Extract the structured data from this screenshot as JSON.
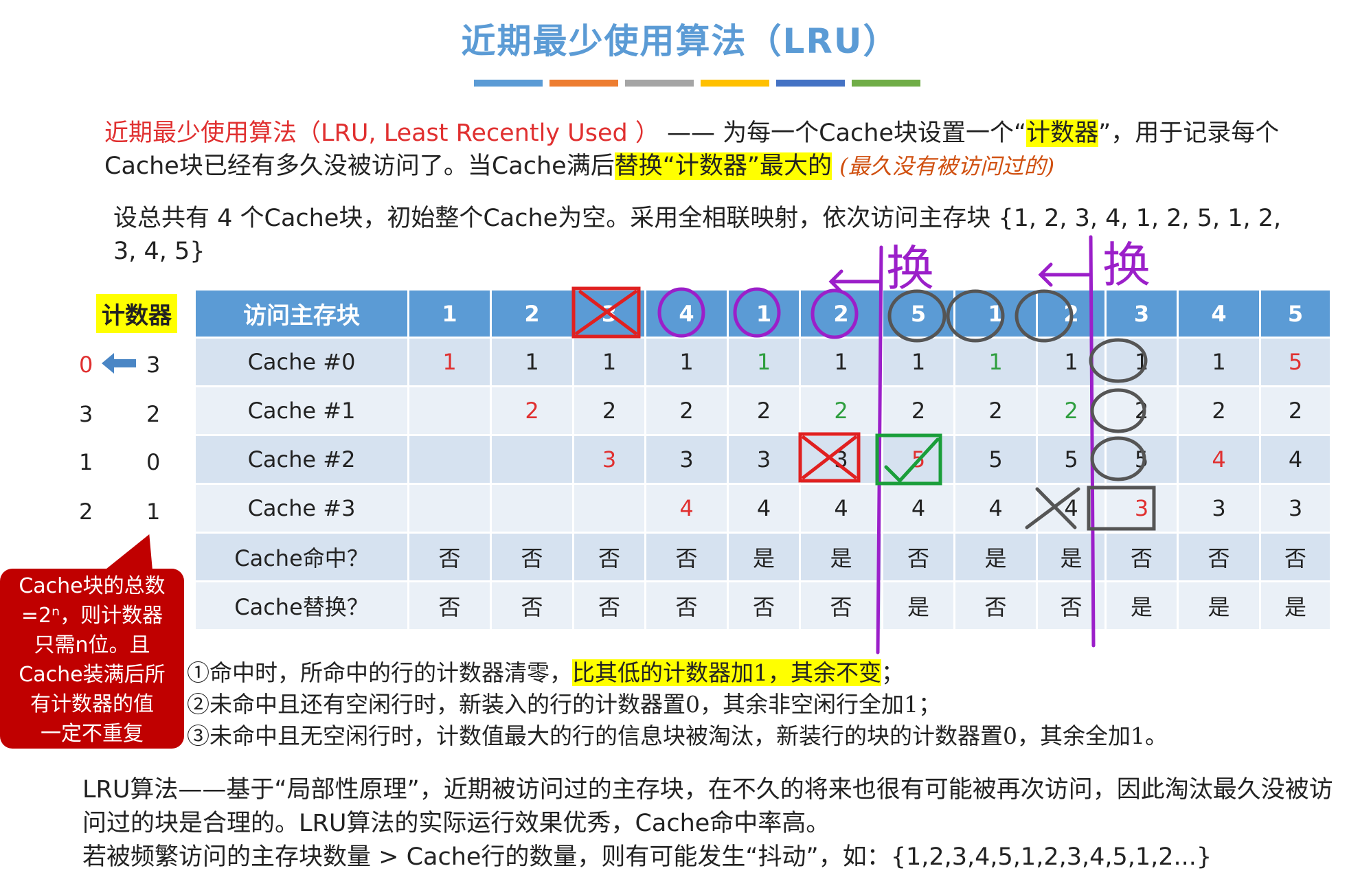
{
  "title": "近期最少使用算法（LRU）",
  "title_bar_colors": [
    "#5b9bd5",
    "#ed7d31",
    "#a5a5a5",
    "#ffc000",
    "#4472c4",
    "#70ad47"
  ],
  "intro": {
    "term": "近期最少使用算法（LRU, Least Recently Used ）",
    "dash": "——",
    "part1": " 为每一个Cache块设置一个“",
    "counter": "计数器",
    "part2": "”，用于记录每个Cache块已经有多久没被访问了。当Cache满后",
    "replace_rule": "替换“计数器”最大的",
    "handwritten_note": "(最久没有被访问过的)"
  },
  "problem": "设总共有 4 个Cache块，初始整个Cache为空。采用全相联映射，依次访问主存块 {1, 2, 3, 4, 1, 2, 5, 1, 2, 3, 4, 5}",
  "counter_label": "计数器",
  "counters": [
    {
      "before": "0",
      "after": "3"
    },
    {
      "before": "3",
      "after": "2"
    },
    {
      "before": "1",
      "after": "0"
    },
    {
      "before": "2",
      "after": "1"
    }
  ],
  "table": {
    "header": "访问主存块",
    "accesses": [
      "1",
      "2",
      "3",
      "4",
      "1",
      "2",
      "5",
      "1",
      "2",
      "3",
      "4",
      "5"
    ],
    "rows": [
      {
        "label": "Cache #0",
        "cells": [
          "1",
          "1",
          "1",
          "1",
          "1",
          "1",
          "1",
          "1",
          "1",
          "1",
          "1",
          "5"
        ],
        "status": [
          "new",
          "",
          "",
          "",
          "hit",
          "",
          "",
          "hit",
          "",
          "",
          "",
          "new"
        ]
      },
      {
        "label": "Cache #1",
        "cells": [
          "",
          "2",
          "2",
          "2",
          "2",
          "2",
          "2",
          "2",
          "2",
          "2",
          "2",
          "2"
        ],
        "status": [
          "",
          "new",
          "",
          "",
          "",
          "hit",
          "",
          "",
          "hit",
          "",
          "",
          ""
        ]
      },
      {
        "label": "Cache #2",
        "cells": [
          "",
          "",
          "3",
          "3",
          "3",
          "3",
          "5",
          "5",
          "5",
          "5",
          "4",
          "4"
        ],
        "status": [
          "",
          "",
          "new",
          "",
          "",
          "",
          "new",
          "",
          "",
          "",
          "new",
          ""
        ]
      },
      {
        "label": "Cache #3",
        "cells": [
          "",
          "",
          "",
          "4",
          "4",
          "4",
          "4",
          "4",
          "4",
          "3",
          "3",
          "3"
        ],
        "status": [
          "",
          "",
          "",
          "new",
          "",
          "",
          "",
          "",
          "",
          "new",
          "",
          ""
        ]
      },
      {
        "label": "Cache命中？",
        "cells": [
          "否",
          "否",
          "否",
          "否",
          "是",
          "是",
          "否",
          "是",
          "是",
          "否",
          "否",
          "否"
        ]
      },
      {
        "label": "Cache替换？",
        "cells": [
          "否",
          "否",
          "否",
          "否",
          "否",
          "否",
          "是",
          "否",
          "否",
          "是",
          "是",
          "是"
        ]
      }
    ]
  },
  "callout": [
    "Cache块的总数",
    "=2ⁿ，则计数器",
    "只需n位。且",
    "Cache装满后所",
    "有计数器的值",
    "一定不重复"
  ],
  "rules": {
    "r1_a": "①命中时，所命中的行的计数器清零，",
    "r1_b": "比其低的计数器加1，其余不变",
    "r1_c": "；",
    "r2": "②未命中且还有空闲行时，新装入的行的计数器置0，其余非空闲行全加1；",
    "r3": "③未命中且无空闲行时，计数值最大的行的信息块被淘汰，新装行的块的计数器置0，其余全加1。"
  },
  "summary": [
    "LRU算法——基于“局部性原理”，近期被访问过的主存块，在不久的将来也很有可能被再次访问，因此淘汰最久没被访问过的块是合理的。LRU算法的实际运行效果优秀，Cache命中率高。",
    "若被频繁访问的主存块数量 > Cache行的数量，则有可能发生“抖动”，如：{1,2,3,4,5,1,2,3,4,5,1,2...}"
  ],
  "annotations": {
    "handwritten_swap": "换",
    "colors": {
      "purple": "#9b1fc9",
      "red": "#e02020",
      "green": "#1a9e3a",
      "gray": "#555555"
    }
  }
}
